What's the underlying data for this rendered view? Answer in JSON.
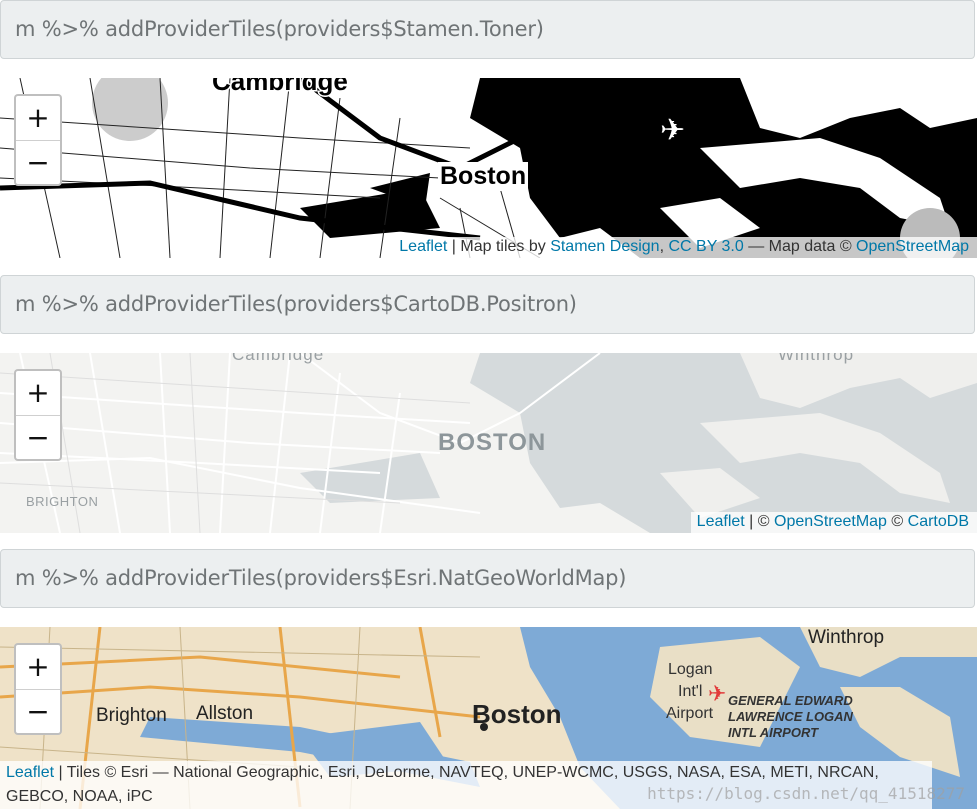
{
  "blocks": [
    {
      "code": "m %>% addProviderTiles(providers$Stamen.Toner)",
      "map": {
        "labels": {
          "city": "Boston",
          "north": "Cambridge"
        },
        "zoom_in": "+",
        "zoom_out": "−",
        "attribution": {
          "leaflet": "Leaflet",
          "sep1": " | Map tiles by ",
          "stamen": "Stamen Design",
          "comma": ", ",
          "license": "CC BY 3.0",
          "mid": " — Map data © ",
          "osm": "OpenStreetMap"
        }
      }
    },
    {
      "code": "m %>% addProviderTiles(providers$CartoDB.Positron)",
      "map": {
        "labels": {
          "city": "BOSTON",
          "north": "Cambridge",
          "northeast": "Winthrop",
          "west": "BRIGHTON"
        },
        "zoom_in": "+",
        "zoom_out": "−",
        "attribution": {
          "leaflet": "Leaflet",
          "sep1": " | © ",
          "osm": "OpenStreetMap",
          "sep2": " © ",
          "carto": "CartoDB"
        }
      }
    },
    {
      "code": "m %>% addProviderTiles(providers$Esri.NatGeoWorldMap)",
      "map": {
        "labels": {
          "city": "Boston",
          "northeast": "Winthrop",
          "brighton": "Brighton",
          "allston": "Allston",
          "logan1": "Logan",
          "logan2": "Int'l",
          "logan3": "Airport",
          "airport1": "GENERAL EDWARD",
          "airport2": "LAWRENCE LOGAN",
          "airport3": "INTL AIRPORT"
        },
        "zoom_in": "+",
        "zoom_out": "−",
        "attribution": {
          "leaflet": "Leaflet",
          "text": " | Tiles © Esri — National Geographic, Esri, DeLorme, NAVTEQ, UNEP-WCMC, USGS, NASA, ESA, METI, NRCAN, GEBCO, NOAA, iPC"
        }
      }
    }
  ],
  "watermark": "https://blog.csdn.net/qq_41518277",
  "colors": {
    "toner_land": "#ffffff",
    "toner_water": "#000000",
    "positron_land": "#f2f2f0",
    "positron_water": "#d4dadc",
    "natgeo_land": "#efe3cb",
    "natgeo_water": "#7aa9d6",
    "link": "#0078a8"
  }
}
